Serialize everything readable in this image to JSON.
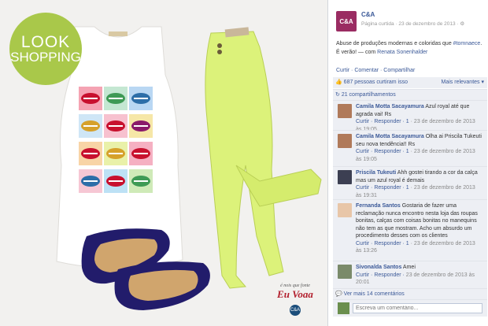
{
  "photo": {
    "badge": {
      "line1": "LOOK",
      "line2": "SHOPPING",
      "color": "#a9c84a"
    },
    "credit": {
      "small": "é nois que fonte",
      "script": "Eu Voaa",
      "logo": "C&A"
    }
  },
  "page": {
    "logo": "C&A",
    "name": "C&A",
    "meta": "Página curtida · 23 de dezembro de 2013 · ⚙",
    "post_text": "Abuse de produções modernas e coloridas que",
    "post_tag": "#tomnaece",
    "post_text2": ". É verão!",
    "post_with": "— com",
    "post_person": "Renata Sonenhalder",
    "actions": "Curtir · Comentar · Compartilhar",
    "likes": "687 pessoas curtiram isso",
    "relevant": "Mais relevantes ▾",
    "shares": "21 compartilhamentos",
    "comments": [
      {
        "name": "Camila Motta Sacayamura",
        "text": "Azul royal até que agrada vai! Rs",
        "meta_actions": "Curtir · Responder · ",
        "likes": "1",
        "date": " · 23 de dezembro de 2013 às 19:05"
      },
      {
        "name": "Camila Motta Sacayamura",
        "text": "Olha ai Priscila Tukeuti seu nova tendência!! Rs",
        "meta_actions": "Curtir · Responder · ",
        "likes": "1",
        "date": " · 23 de dezembro de 2013 às 19:05"
      },
      {
        "name": "Priscila Tukeuti",
        "text": "Ahh gostei tirando a cor da calça mas um azul royal é demais",
        "meta_actions": "Curtir · Responder · ",
        "likes": "1",
        "date": " · 23 de dezembro de 2013 às 19:31"
      },
      {
        "name": "Fernanda Santos",
        "text": "Gostaria de fazer uma reclamação nunca encontro nesta loja das roupas bonitas, calças com coisas bonitas no manequins não tem as que mostram. Acho um absurdo um procedimento desses com os clientes",
        "meta_actions": "Curtir · Responder · ",
        "likes": "1",
        "date": " · 23 de dezembro de 2013 às 13:26"
      },
      {
        "name": "Sivonalda Santos",
        "text": "Amei",
        "meta_actions": "Curtir · Responder · ",
        "likes": "",
        "date": "23 de dezembro de 2013 às 20:01"
      }
    ],
    "more": "Ver mais 14 comentários",
    "write_placeholder": "Escreva um comentário..."
  }
}
